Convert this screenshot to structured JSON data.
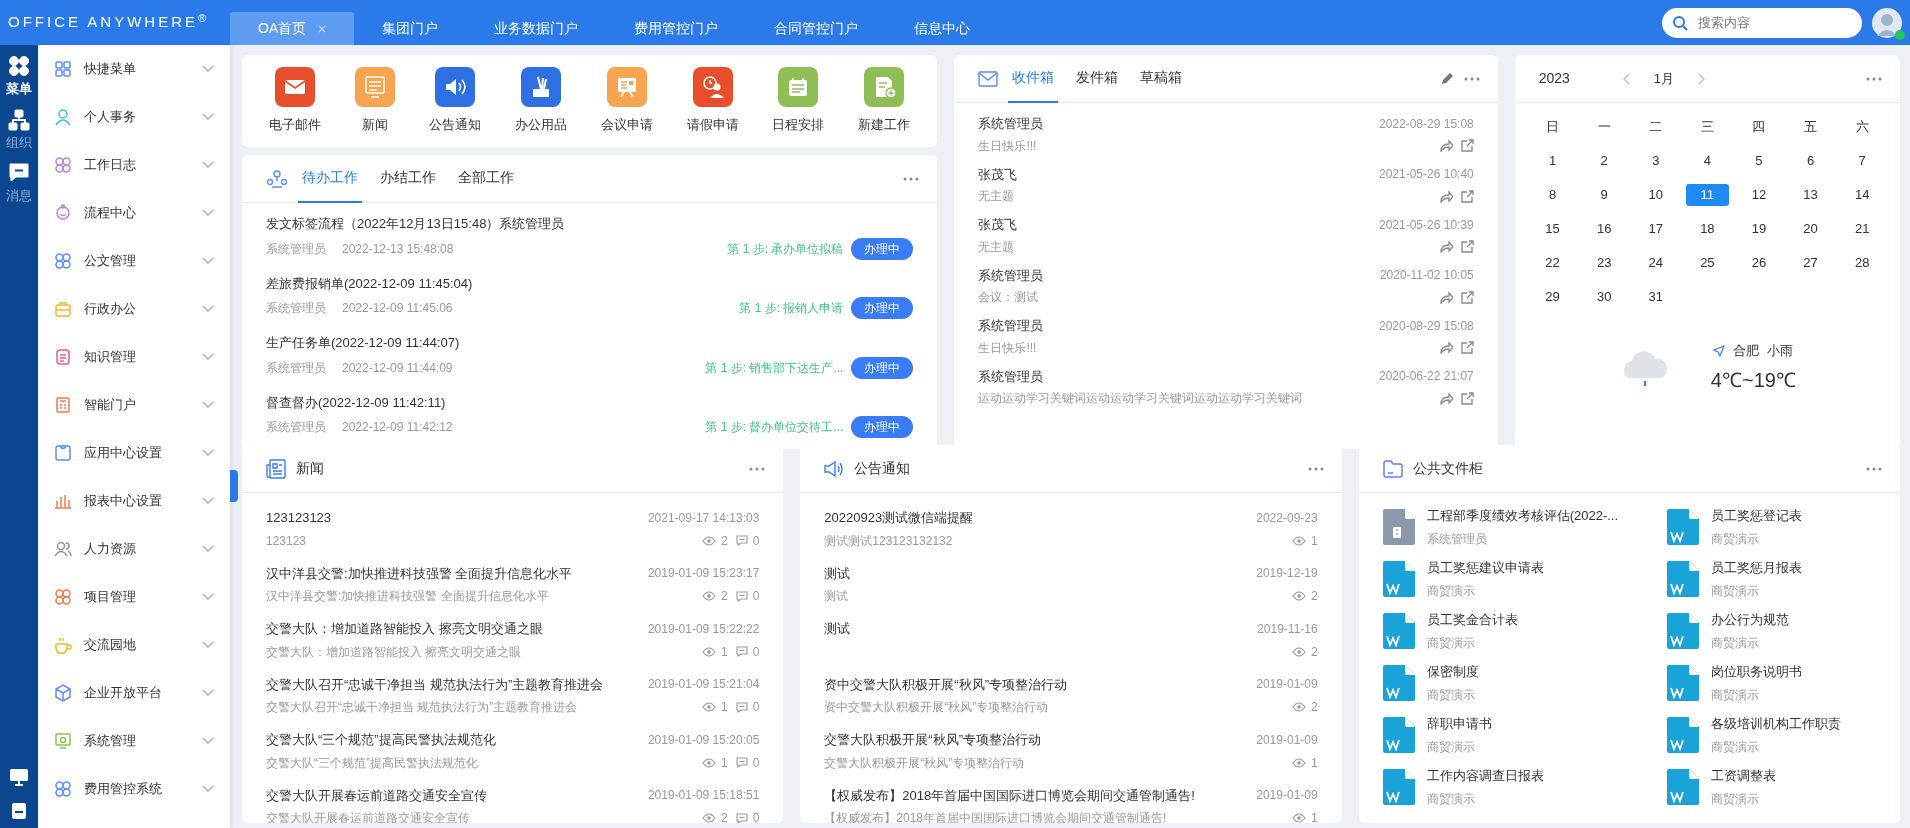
{
  "header": {
    "logo": "OFFICE ANYWHERE$^{®}$",
    "tabs": [
      {
        "label": "OA首页",
        "selected": true,
        "closable": true
      },
      {
        "label": "集团门户",
        "selected": false,
        "closable": false
      },
      {
        "label": "业务数据门户",
        "selected": false,
        "closable": false
      },
      {
        "label": "费用管控门户",
        "selected": false,
        "closable": false
      },
      {
        "label": "合同管控门户",
        "selected": false,
        "closable": false
      },
      {
        "label": "信息中心",
        "selected": false,
        "closable": false
      }
    ],
    "search": {
      "placeholder": "搜索内容"
    },
    "user": {
      "online": true
    }
  },
  "rail": {
    "items": [
      {
        "label": "菜单",
        "selected": true
      },
      {
        "label": "组织",
        "selected": false
      },
      {
        "label": "消息",
        "selected": false
      }
    ]
  },
  "menu": {
    "items": [
      {
        "label": "快捷菜单"
      },
      {
        "label": "个人事务"
      },
      {
        "label": "工作日志"
      },
      {
        "label": "流程中心"
      },
      {
        "label": "公文管理"
      },
      {
        "label": "行政办公"
      },
      {
        "label": "知识管理"
      },
      {
        "label": "智能门户"
      },
      {
        "label": "应用中心设置"
      },
      {
        "label": "报表中心设置"
      },
      {
        "label": "人力资源"
      },
      {
        "label": "项目管理"
      },
      {
        "label": "交流园地"
      },
      {
        "label": "企业开放平台"
      },
      {
        "label": "系统管理"
      },
      {
        "label": "费用管控系统"
      }
    ]
  },
  "apps": [
    {
      "label": "电子邮件",
      "color": "#e84d2c"
    },
    {
      "label": "新闻",
      "color": "#f7a450"
    },
    {
      "label": "公告通知",
      "color": "#2f6fe4"
    },
    {
      "label": "办公用品",
      "color": "#2f6fe4"
    },
    {
      "label": "会议申请",
      "color": "#f7a450"
    },
    {
      "label": "请假申请",
      "color": "#e84d2c"
    },
    {
      "label": "日程安排",
      "color": "#8fbd56"
    },
    {
      "label": "新建工作",
      "color": "#8fbd56"
    }
  ],
  "work": {
    "tabs": [
      {
        "label": "待办工作",
        "selected": true
      },
      {
        "label": "办结工作",
        "selected": false
      },
      {
        "label": "全部工作",
        "selected": false
      }
    ],
    "items": [
      {
        "title": "发文标签流程（2022年12月13日15:48）系统管理员",
        "author": "系统管理员",
        "time": "2022-12-13 15:48:08",
        "step": "第 1 步: 承办单位拟稿",
        "status": "办理中"
      },
      {
        "title": "差旅费报销单(2022-12-09 11:45:04)",
        "author": "系统管理员",
        "time": "2022-12-09 11:45:06",
        "step": "第 1 步: 报销人申请",
        "status": "办理中"
      },
      {
        "title": "生产任务单(2022-12-09 11:44:07)",
        "author": "系统管理员",
        "time": "2022-12-09 11:44:09",
        "step": "第 1 步: 销售部下达生产...",
        "status": "办理中"
      },
      {
        "title": "督查督办(2022-12-09 11:42:11)",
        "author": "系统管理员",
        "time": "2022-12-09 11:42:12",
        "step": "第 1 步: 督办单位交待工...",
        "status": "办理中"
      }
    ]
  },
  "mail": {
    "tabs": [
      {
        "label": "收件箱",
        "selected": true
      },
      {
        "label": "发件箱",
        "selected": false
      },
      {
        "label": "草稿箱",
        "selected": false
      }
    ],
    "items": [
      {
        "sender": "系统管理员",
        "subject": "生日快乐!!!",
        "time": "2022-08-29 15:08"
      },
      {
        "sender": "张茂飞",
        "subject": "无主题",
        "time": "2021-05-26 10:40"
      },
      {
        "sender": "张茂飞",
        "subject": "无主题",
        "time": "2021-05-26 10:39"
      },
      {
        "sender": "系统管理员",
        "subject": "会议：测试",
        "time": "2020-11-02 10:05"
      },
      {
        "sender": "系统管理员",
        "subject": "生日快乐!!!",
        "time": "2020-08-29 15:08"
      },
      {
        "sender": "系统管理员",
        "subject": "运动运动学习关键词运动运动学习关键词运动运动学习关键词",
        "time": "2020-06-22 21:07"
      }
    ]
  },
  "calendar": {
    "year": "2023",
    "month": "1月",
    "weekdays": [
      "日",
      "一",
      "二",
      "三",
      "四",
      "五",
      "六"
    ],
    "days": [
      {
        "label": "1",
        "selected": false
      },
      {
        "label": "2",
        "selected": false
      },
      {
        "label": "3",
        "selected": false
      },
      {
        "label": "4",
        "selected": false
      },
      {
        "label": "5",
        "selected": false
      },
      {
        "label": "6",
        "selected": false
      },
      {
        "label": "7",
        "selected": false
      },
      {
        "label": "8",
        "selected": false
      },
      {
        "label": "9",
        "selected": false
      },
      {
        "label": "10",
        "selected": false
      },
      {
        "label": "11",
        "selected": true
      },
      {
        "label": "12",
        "selected": false
      },
      {
        "label": "13",
        "selected": false
      },
      {
        "label": "14",
        "selected": false
      },
      {
        "label": "15",
        "selected": false
      },
      {
        "label": "16",
        "selected": false
      },
      {
        "label": "17",
        "selected": false
      },
      {
        "label": "18",
        "selected": false
      },
      {
        "label": "19",
        "selected": false
      },
      {
        "label": "20",
        "selected": false
      },
      {
        "label": "21",
        "selected": false
      },
      {
        "label": "22",
        "selected": false
      },
      {
        "label": "23",
        "selected": false
      },
      {
        "label": "24",
        "selected": false
      },
      {
        "label": "25",
        "selected": false
      },
      {
        "label": "26",
        "selected": false
      },
      {
        "label": "27",
        "selected": false
      },
      {
        "label": "28",
        "selected": false
      },
      {
        "label": "29",
        "selected": false
      },
      {
        "label": "30",
        "selected": false
      },
      {
        "label": "31",
        "selected": false
      }
    ],
    "weather": {
      "city": "合肥",
      "condition": "小雨",
      "temperature": "4℃~19℃"
    }
  },
  "news": {
    "title": "新闻",
    "items": [
      {
        "title": "123123123",
        "summary": "123123",
        "time": "2021-09-17 14:13:03",
        "views": "2",
        "comments": "0"
      },
      {
        "title": "汉中洋县交警:加快推进科技强警 全面提升信息化水平",
        "summary": "汉中洋县交警:加快推进科技强警 全面提升信息化水平",
        "time": "2019-01-09 15:23:17",
        "views": "2",
        "comments": "0"
      },
      {
        "title": "交警大队：增加道路智能投入 擦亮文明交通之眼",
        "summary": "交警大队：增加道路智能投入 擦亮文明交通之眼",
        "time": "2019-01-09 15:22:22",
        "views": "1",
        "comments": "0"
      },
      {
        "title": "交警大队召开“忠诚干净担当 规范执法行为”主题教育推进会",
        "summary": "交警大队召开“忠诚干净担当 规范执法行为”主题教育推进会",
        "time": "2019-01-09 15:21:04",
        "views": "1",
        "comments": "0"
      },
      {
        "title": "交警大队“三个规范”提高民警执法规范化",
        "summary": "交警大队“三个规范”提高民警执法规范化",
        "time": "2019-01-09 15:20:05",
        "views": "1",
        "comments": "0"
      },
      {
        "title": "交警大队开展春运前道路交通安全宣传",
        "summary": "交警大队开展春运前道路交通安全宣传",
        "time": "2019-01-09 15:18:51",
        "views": "2",
        "comments": "0"
      }
    ]
  },
  "notices": {
    "title": "公告通知",
    "items": [
      {
        "title": "20220923测试微信端提醒",
        "summary": "测试测试123123132132",
        "date": "2022-09-23",
        "views": "1"
      },
      {
        "title": "测试",
        "summary": "测试",
        "date": "2019-12-19",
        "views": "2"
      },
      {
        "title": "测试",
        "date": "2019-11-16",
        "views": "2"
      },
      {
        "title": "资中交警大队积极开展“秋风”专项整治行动",
        "summary": "资中交警大队积极开展“秋风”专项整治行动",
        "date": "2019-01-09",
        "views": "2"
      },
      {
        "title": "交警大队积极开展“秋风”专项整治行动",
        "summary": "交警大队积极开展“秋风”专项整治行动",
        "date": "2019-01-09",
        "views": "1"
      },
      {
        "title": "【权威发布】2018年首届中国国际进口博览会期间交通管制通告!",
        "summary": "【权威发布】2018年首届中国国际进口博览会期间交通管制通告!",
        "date": "2019-01-09",
        "views": "1"
      }
    ]
  },
  "files": {
    "title": "公共文件柜",
    "items": [
      {
        "name": "工程部季度绩效考核评估(2022-...",
        "owner": "系统管理员",
        "kind": "zip"
      },
      {
        "name": "员工奖惩登记表",
        "owner": "商贸演示",
        "kind": "word"
      },
      {
        "name": "员工奖惩建议申请表",
        "owner": "商贸演示",
        "kind": "word"
      },
      {
        "name": "员工奖惩月报表",
        "owner": "商贸演示",
        "kind": "word"
      },
      {
        "name": "员工奖金合计表",
        "owner": "商贸演示",
        "kind": "word"
      },
      {
        "name": "办公行为规范",
        "owner": "商贸演示",
        "kind": "word"
      },
      {
        "name": "保密制度",
        "owner": "商贸演示",
        "kind": "word"
      },
      {
        "name": "岗位职务说明书",
        "owner": "商贸演示",
        "kind": "word"
      },
      {
        "name": "辞职申请书",
        "owner": "商贸演示",
        "kind": "word"
      },
      {
        "name": "各级培训机构工作职责",
        "owner": "商贸演示",
        "kind": "word"
      },
      {
        "name": "工作内容调查日报表",
        "owner": "商贸演示",
        "kind": "word"
      },
      {
        "name": "工资调整表",
        "owner": "商贸演示",
        "kind": "word"
      }
    ]
  }
}
